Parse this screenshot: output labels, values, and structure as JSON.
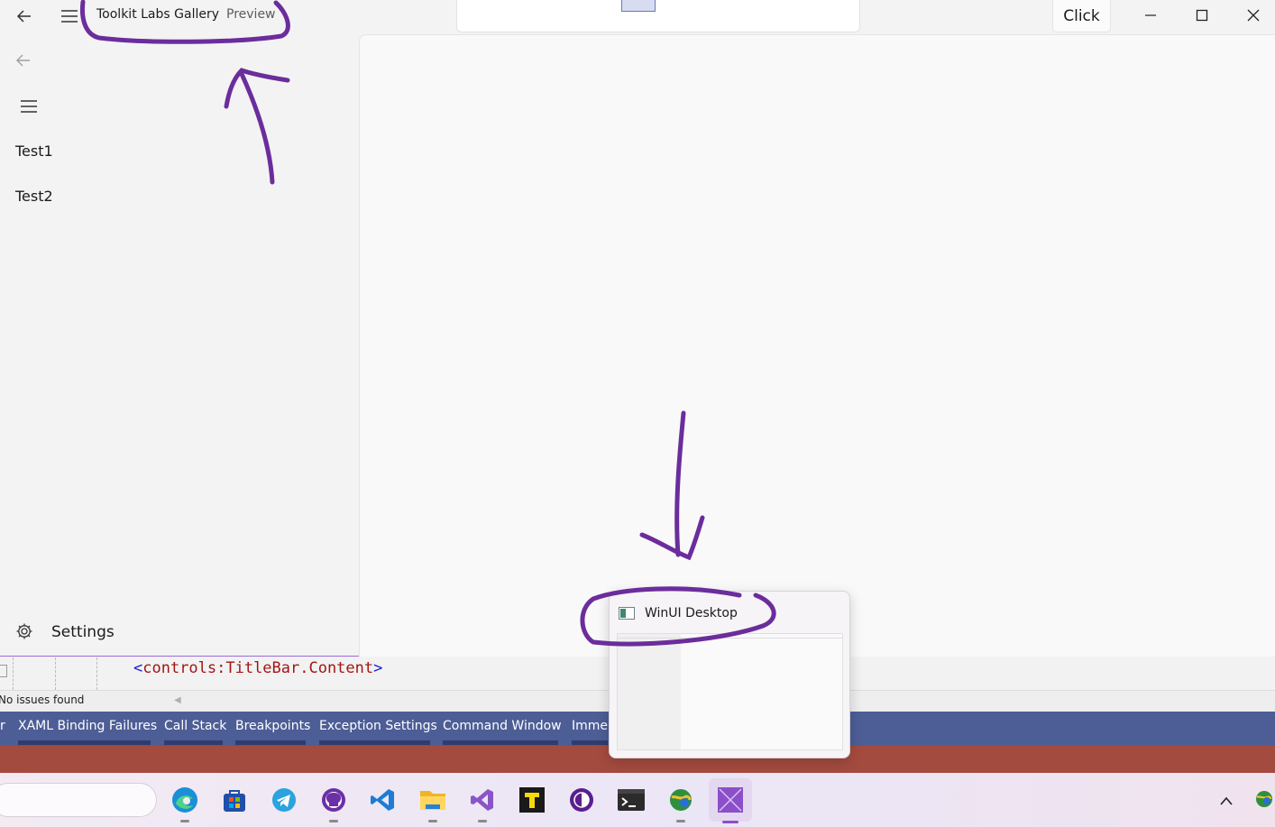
{
  "app": {
    "title": "Toolkit Labs Gallery",
    "subtitle": "Preview",
    "click_button": "Click",
    "nav_items": [
      "Test1",
      "Test2"
    ],
    "settings_label": "Settings"
  },
  "editor": {
    "code_open": "<",
    "code_tag": "controls:TitleBar.Content",
    "code_close": ">",
    "issues": "No issues found",
    "tabs": [
      "r",
      "XAML Binding Failures",
      "Call Stack",
      "Breakpoints",
      "Exception Settings",
      "Command Window",
      "Imme"
    ]
  },
  "thumbnail": {
    "title": "WinUI Desktop"
  },
  "colors": {
    "ink": "#6b2d9c",
    "toolbar": "#4d5e96",
    "status": "#a44b3f"
  },
  "taskbar_icons": [
    "edge-icon",
    "store-icon",
    "telegram-icon",
    "github-desktop-icon",
    "vscode-icon",
    "file-explorer-icon",
    "visual-studio-icon",
    "typora-icon",
    "tor-browser-icon",
    "terminal-icon",
    "globe-app-icon",
    "winui-app-icon"
  ]
}
